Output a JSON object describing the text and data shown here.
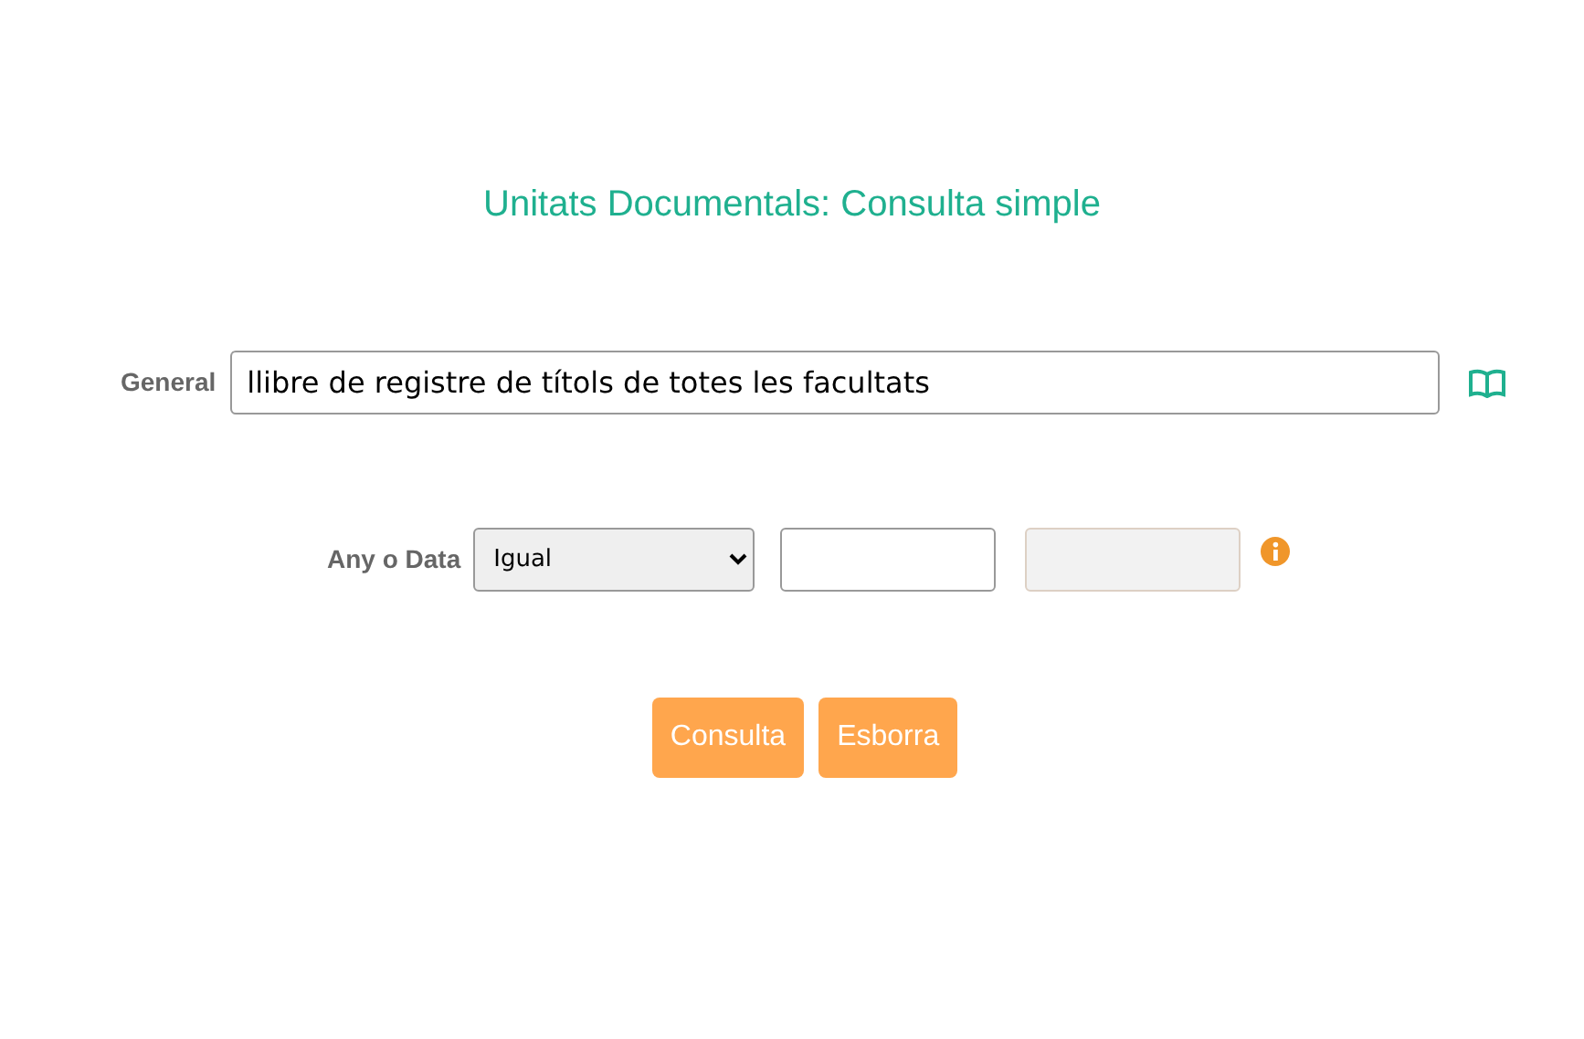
{
  "title": "Unitats Documentals: Consulta simple",
  "general": {
    "label": "General",
    "value": "llibre de registre de títols de totes les facultats"
  },
  "date": {
    "label": "Any o Data",
    "operator": "Igual",
    "from": {
      "disabled": false
    },
    "to": {
      "disabled": true
    }
  },
  "buttons": [
    "Consulta",
    "Esborra"
  ]
}
